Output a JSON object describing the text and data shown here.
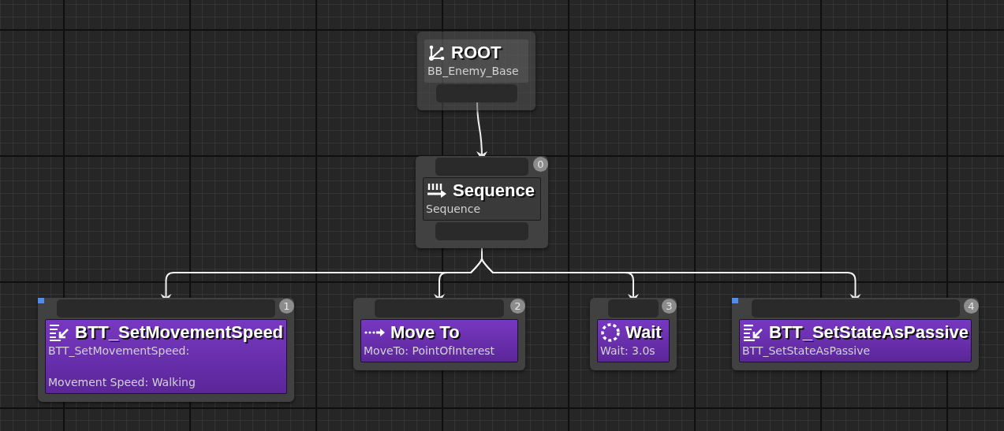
{
  "root": {
    "title": "ROOT",
    "subtitle": "BB_Enemy_Base"
  },
  "composite": {
    "kind": "sequence",
    "title": "Sequence",
    "subtitle": "Sequence",
    "index": "0"
  },
  "tasks": [
    {
      "kind": "blueprint",
      "title": "BTT_SetMovementSpeed",
      "description": "BTT_SetMovementSpeed:\n\nMovement Speed: Walking",
      "index": "1"
    },
    {
      "kind": "move_to",
      "title": "Move To",
      "description": "MoveTo: PointOfInterest",
      "index": "2"
    },
    {
      "kind": "wait",
      "title": "Wait",
      "description": "Wait: 3.0s",
      "index": "3"
    },
    {
      "kind": "blueprint",
      "title": "BTT_SetStateAsPassive",
      "description": "BTT_SetStateAsPassive",
      "index": "4"
    }
  ]
}
